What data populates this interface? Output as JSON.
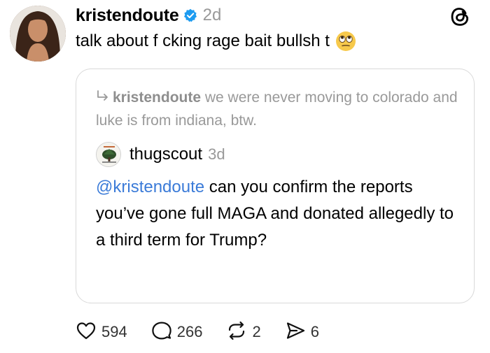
{
  "post": {
    "username": "kristendoute",
    "time": "2d",
    "text": "talk about f  cking rage bait bullsh t",
    "emoji": "eye-roll-emoji"
  },
  "quoted": {
    "reply_to_user": "kristendoute",
    "reply_to_text": " we were never moving to colorado and luke is from indiana, btw.",
    "username": "thugscout",
    "time": "3d",
    "mention": "@kristendoute",
    "text": " can you confirm the reports you’ve gone full MAGA and donated allegedly to a third term for Trump?"
  },
  "actions": {
    "likes": "594",
    "comments": "266",
    "reposts": "2",
    "shares": "6"
  },
  "colors": {
    "verified": "#1d9bf0",
    "mention": "#3b7bd8",
    "muted": "#999999",
    "border": "#d9d9d9"
  },
  "icons": [
    "verified-badge-icon",
    "threads-logo-icon",
    "reply-arrow-icon",
    "heart-icon",
    "comment-icon",
    "repost-icon",
    "share-icon"
  ]
}
